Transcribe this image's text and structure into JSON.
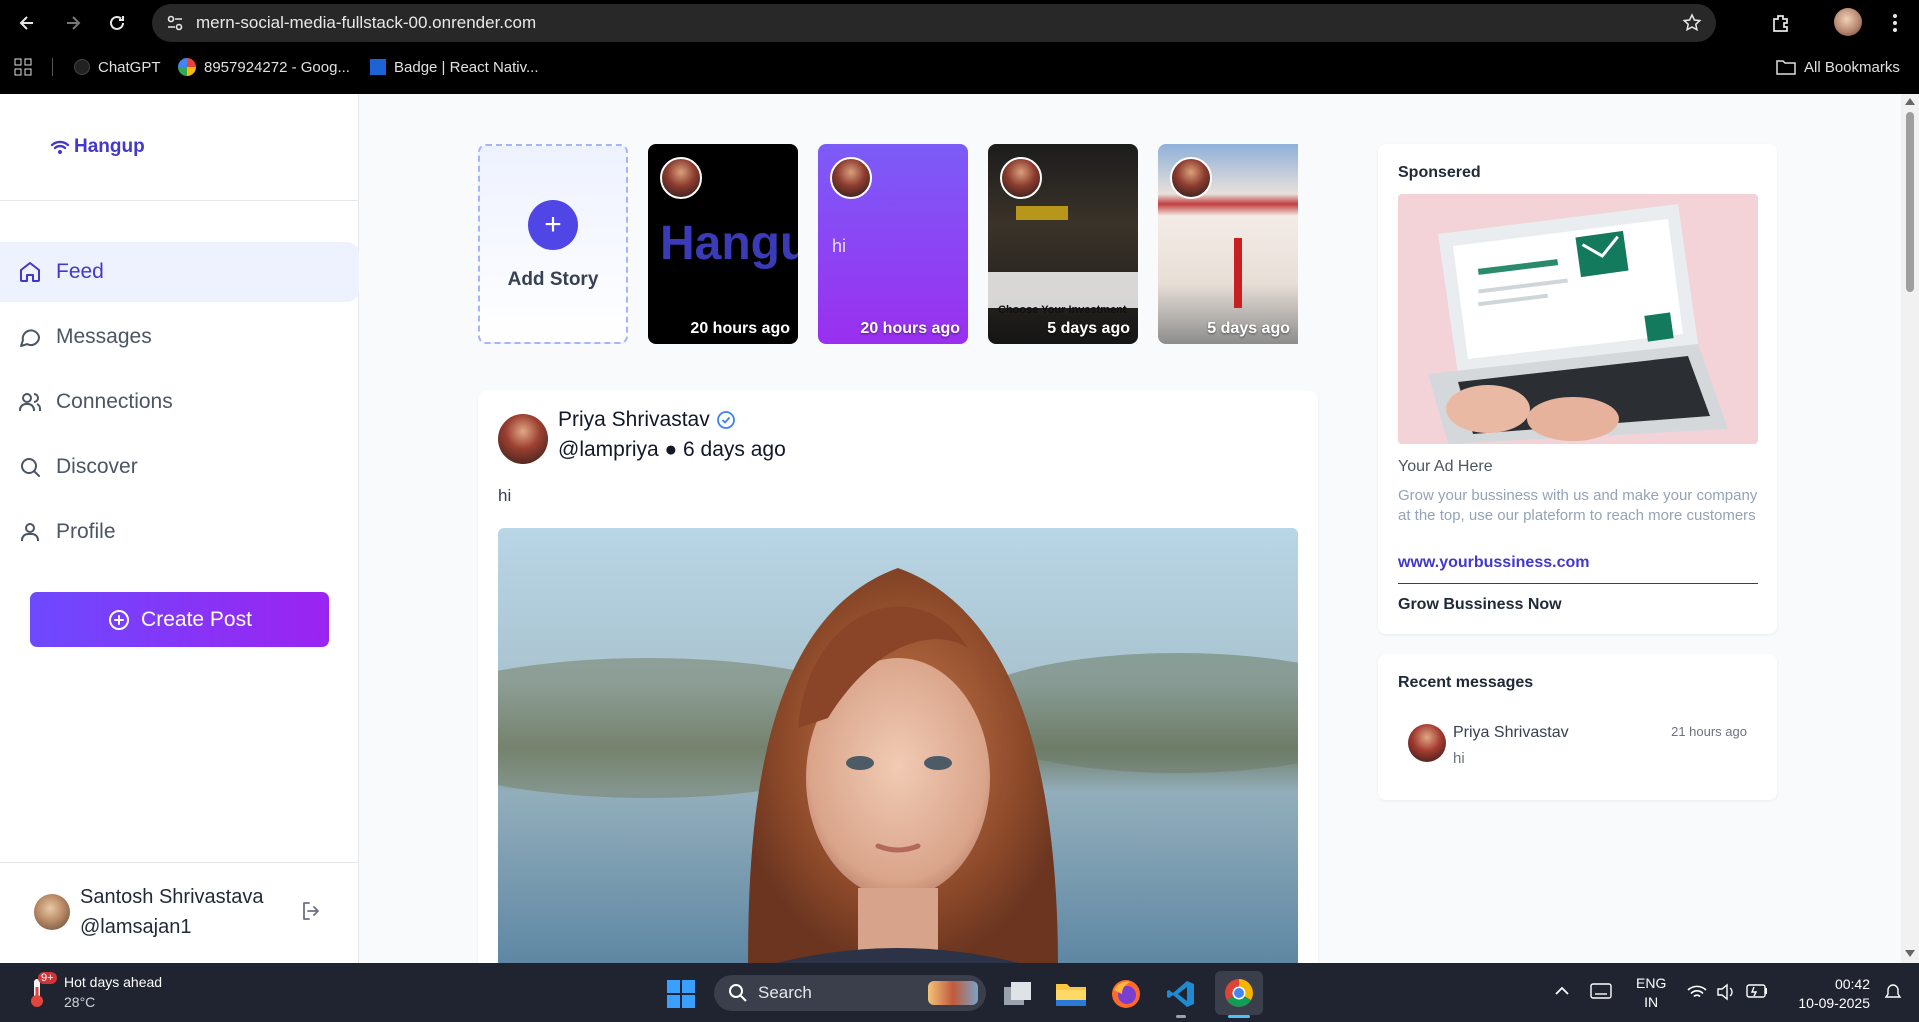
{
  "browser": {
    "url": "mern-social-media-fullstack-00.onrender.com",
    "bookmarks": [
      {
        "label": "ChatGPT"
      },
      {
        "label": "8957924272 - Goog..."
      },
      {
        "label": "Badge | React Nativ..."
      }
    ],
    "all_bookmarks": "All Bookmarks"
  },
  "app": {
    "logo": "Hangup"
  },
  "sidebar": {
    "items": [
      {
        "label": "Feed",
        "icon": "home-icon",
        "active": true
      },
      {
        "label": "Messages",
        "icon": "message-icon",
        "active": false
      },
      {
        "label": "Connections",
        "icon": "users-icon",
        "active": false
      },
      {
        "label": "Discover",
        "icon": "search-icon",
        "active": false
      },
      {
        "label": "Profile",
        "icon": "user-icon",
        "active": false
      }
    ],
    "create_post": "Create Post",
    "user": {
      "name": "Santosh Shrivastava",
      "handle": "@lamsajan1"
    }
  },
  "stories": {
    "add_label": "Add Story",
    "items": [
      {
        "text": "Hangu",
        "time": "20 hours ago",
        "style": "dark"
      },
      {
        "text": "hi",
        "time": "20 hours ago",
        "style": "purple"
      },
      {
        "text": "Choose Your Investment",
        "time": "5 days ago",
        "style": "photo"
      },
      {
        "text": "",
        "time": "5 days ago",
        "style": "building"
      }
    ]
  },
  "post": {
    "author": "Priya Shrivastav",
    "verified": true,
    "meta": "@lampriya ● 6 days ago",
    "text": "hi"
  },
  "ad": {
    "heading": "Sponsered",
    "title": "Your Ad Here",
    "description": "Grow your bussiness with us and make your company at the top, use our plateform to reach more customers",
    "link": "www.yourbussiness.com",
    "cta": "Grow Bussiness Now"
  },
  "recent_messages": {
    "heading": "Recent messages",
    "items": [
      {
        "name": "Priya Shrivastav",
        "text": "hi",
        "time": "21 hours ago"
      }
    ]
  },
  "taskbar": {
    "weather_badge": "9+",
    "weather_title": "Hot days ahead",
    "weather_temp": "28°C",
    "search_placeholder": "Search",
    "language": "ENG",
    "region": "IN",
    "time": "00:42",
    "date": "10-09-2025"
  },
  "colors": {
    "accent": "#4338ca",
    "create_post_gradient": [
      "#6d4aff",
      "#9b23f0"
    ],
    "page_bg": "#f8fafc"
  }
}
